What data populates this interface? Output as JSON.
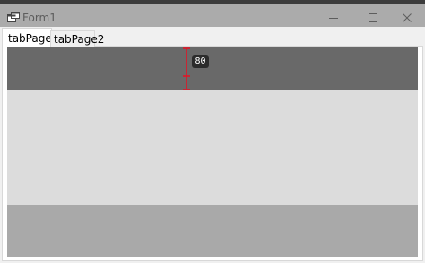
{
  "window": {
    "title": "Form1",
    "icons": {
      "app": "app-window-icon",
      "minimize": "minimize-icon",
      "maximize": "maximize-icon",
      "close": "close-icon"
    }
  },
  "tabs": [
    {
      "label": "tabPage1",
      "selected": true
    },
    {
      "label": "tabPage2",
      "selected": false
    }
  ],
  "panels": {
    "top_color": "#696969",
    "middle_color": "#dcdcdc",
    "bottom_color": "#a9a9a9"
  },
  "measurement": {
    "value": "80",
    "color": "#e81123"
  }
}
